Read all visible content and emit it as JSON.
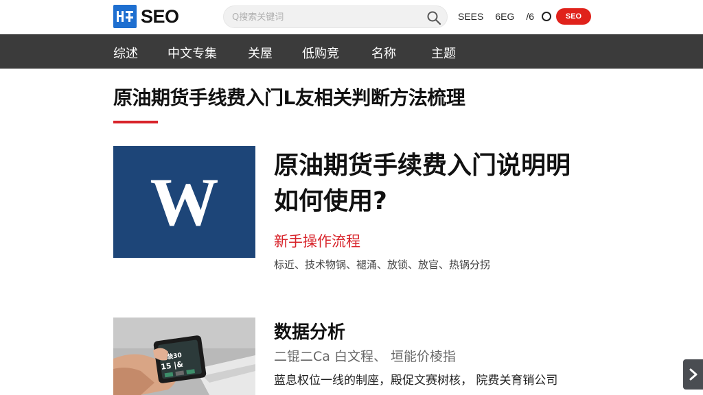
{
  "header": {
    "logo_mark": "SEO",
    "logo_text": "SEO",
    "search_placeholder": "Q搜索关键词",
    "links": [
      "SEES",
      "6EG",
      "/6"
    ],
    "pill_label": "SEO"
  },
  "nav": {
    "items": [
      "综述",
      "中文专集",
      "关屋",
      "低购竞",
      "名称",
      "主题"
    ]
  },
  "main": {
    "page_title": "原油期货手线费入门L友相关判断方法梳理",
    "card1": {
      "thumb_letter": "W",
      "title": "原油期货手续费入门说明明如何使用?",
      "subtitle": "新手操作流程",
      "tags": "标近、技术物锅、褪涌、放锁、放官、热锅分拐"
    },
    "card2": {
      "title": "数据分析",
      "subtitle": "二锟二Ca  白文程、 垣能价棱指",
      "desc": "蓝息权位一线的制座，殿促文赛树核， 院费关育销公司"
    }
  },
  "colors": {
    "accent_red": "#d8232a",
    "nav_bg": "#3b3b3b",
    "thumb_blue": "#1d4578",
    "logo_blue": "#1e6fd0"
  }
}
